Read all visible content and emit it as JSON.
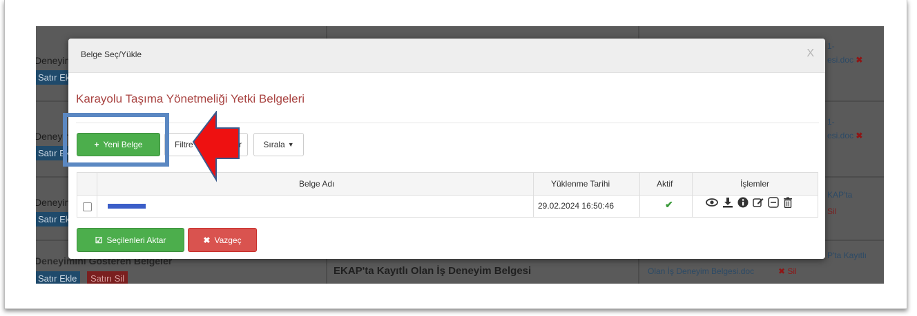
{
  "background": {
    "left_rows": [
      {
        "text": "Deneyim",
        "button": "Satır Ekle"
      },
      {
        "text": "Deneyim",
        "button": "Satır Ekle"
      },
      {
        "text": "Deneyim",
        "button": "Satır Ekle"
      },
      {
        "text": "Deneyimini Gösteren Belgeler",
        "button": "Satır Ekle",
        "button2": "Satırı Sil"
      }
    ],
    "right_fragments": [
      "1-",
      "esi.doc",
      "1-",
      "esi.doc",
      "KAP'ta",
      "Sil",
      "P'ta Kayıtlı"
    ],
    "bottom_center": "EKAP'ta Kayıtlı Olan İş Deneyim Belgesi",
    "bottom_link": "Olan İş Deneyim Belgesi.doc",
    "bottom_delete": "✖ Sil"
  },
  "modal": {
    "title": "Belge Seç/Yükle",
    "close": "X",
    "section_title": "Karayolu Taşıma Yönetmeliği Yetki Belgeleri",
    "toolbar": {
      "new_label": "Yeni Belge",
      "filter_label": "Filtre",
      "sort_label": "Sırala",
      "filter_remainder": "r"
    },
    "table": {
      "headers": [
        "Belge Adı",
        "Yüklenme Tarihi",
        "Aktif",
        "İşlemler"
      ],
      "rows": [
        {
          "name": "",
          "date": "29.02.2024 16:50:46",
          "active": "✔"
        }
      ],
      "ops_icons": [
        "eye-icon",
        "download-icon",
        "info-icon",
        "edit-icon",
        "minus-square-icon",
        "trash-icon"
      ]
    },
    "footer": {
      "transfer_label": "Seçilenleri Aktar",
      "cancel_label": "Vazgeç"
    }
  },
  "colors": {
    "section_title": "#a94442",
    "success": "#4cae4c",
    "danger": "#d9534f",
    "highlight_border": "#5b88c2",
    "arrow_fill": "#ee1111"
  }
}
